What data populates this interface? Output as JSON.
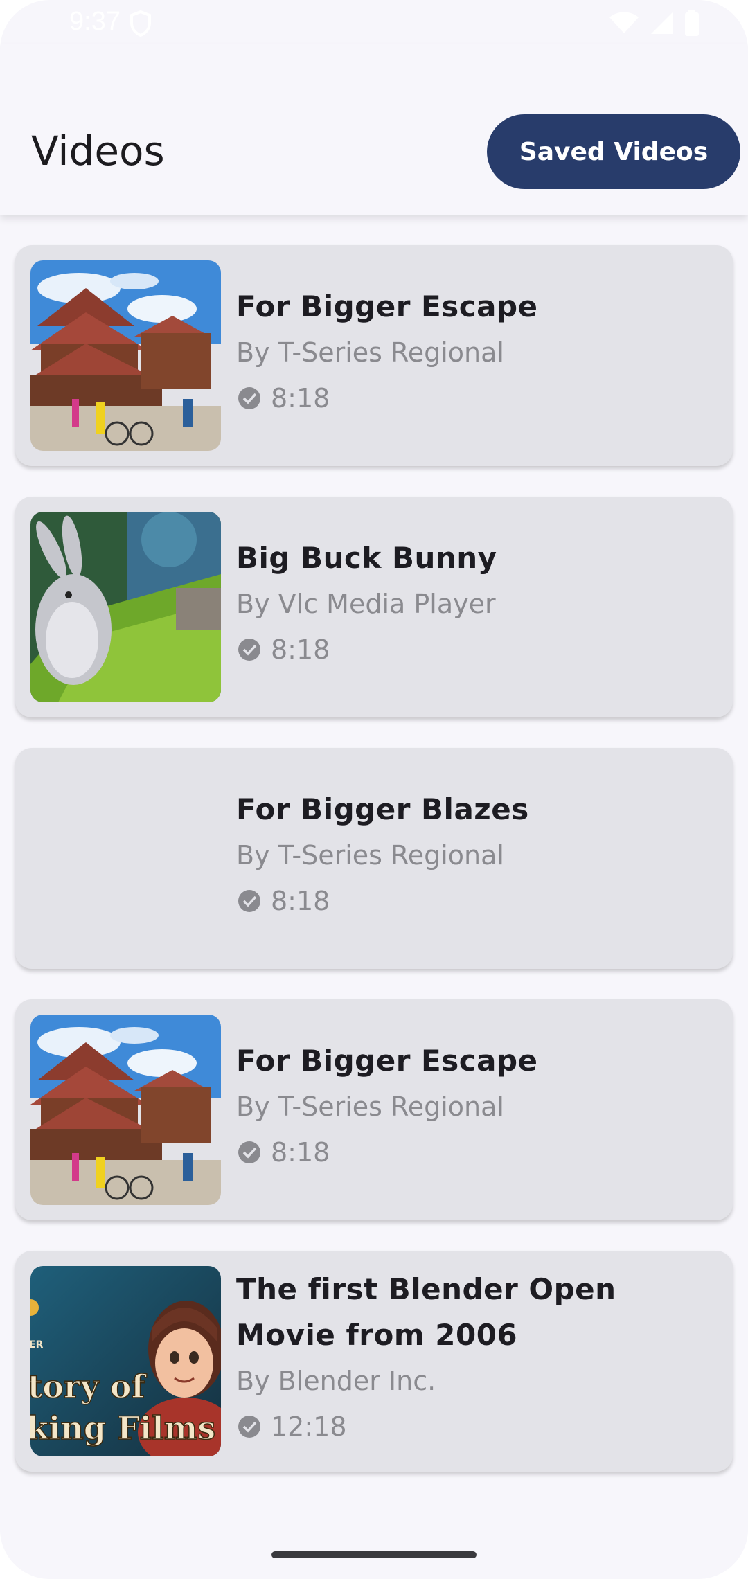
{
  "status_bar": {
    "time": "9:37"
  },
  "app_bar": {
    "title": "Videos",
    "saved_button_label": "Saved Videos"
  },
  "videos": [
    {
      "title": "For Bigger Escape",
      "author": "By T-Series Regional",
      "duration": "8:18",
      "thumbnail": "temple-scene"
    },
    {
      "title": "Big Buck Bunny",
      "author": "By Vlc Media Player",
      "duration": "8:18",
      "thumbnail": "bunny-scene"
    },
    {
      "title": "For Bigger Blazes",
      "author": "By T-Series Regional",
      "duration": "8:18",
      "thumbnail": "none"
    },
    {
      "title": "For Bigger Escape",
      "author": "By T-Series Regional",
      "duration": "8:18",
      "thumbnail": "temple-scene"
    },
    {
      "title": "The first Blender Open Movie from 2006",
      "author": "By Blender Inc.",
      "duration": "12:18",
      "thumbnail": "animated-film-poster",
      "thumbnail_text": [
        "tory of",
        "king Films"
      ]
    }
  ],
  "colors": {
    "background": "#f7f6fb",
    "card": "#e3e3e8",
    "accent": "#283c6b",
    "title_text": "#1d1c22",
    "secondary_text": "#8a8a8f"
  }
}
